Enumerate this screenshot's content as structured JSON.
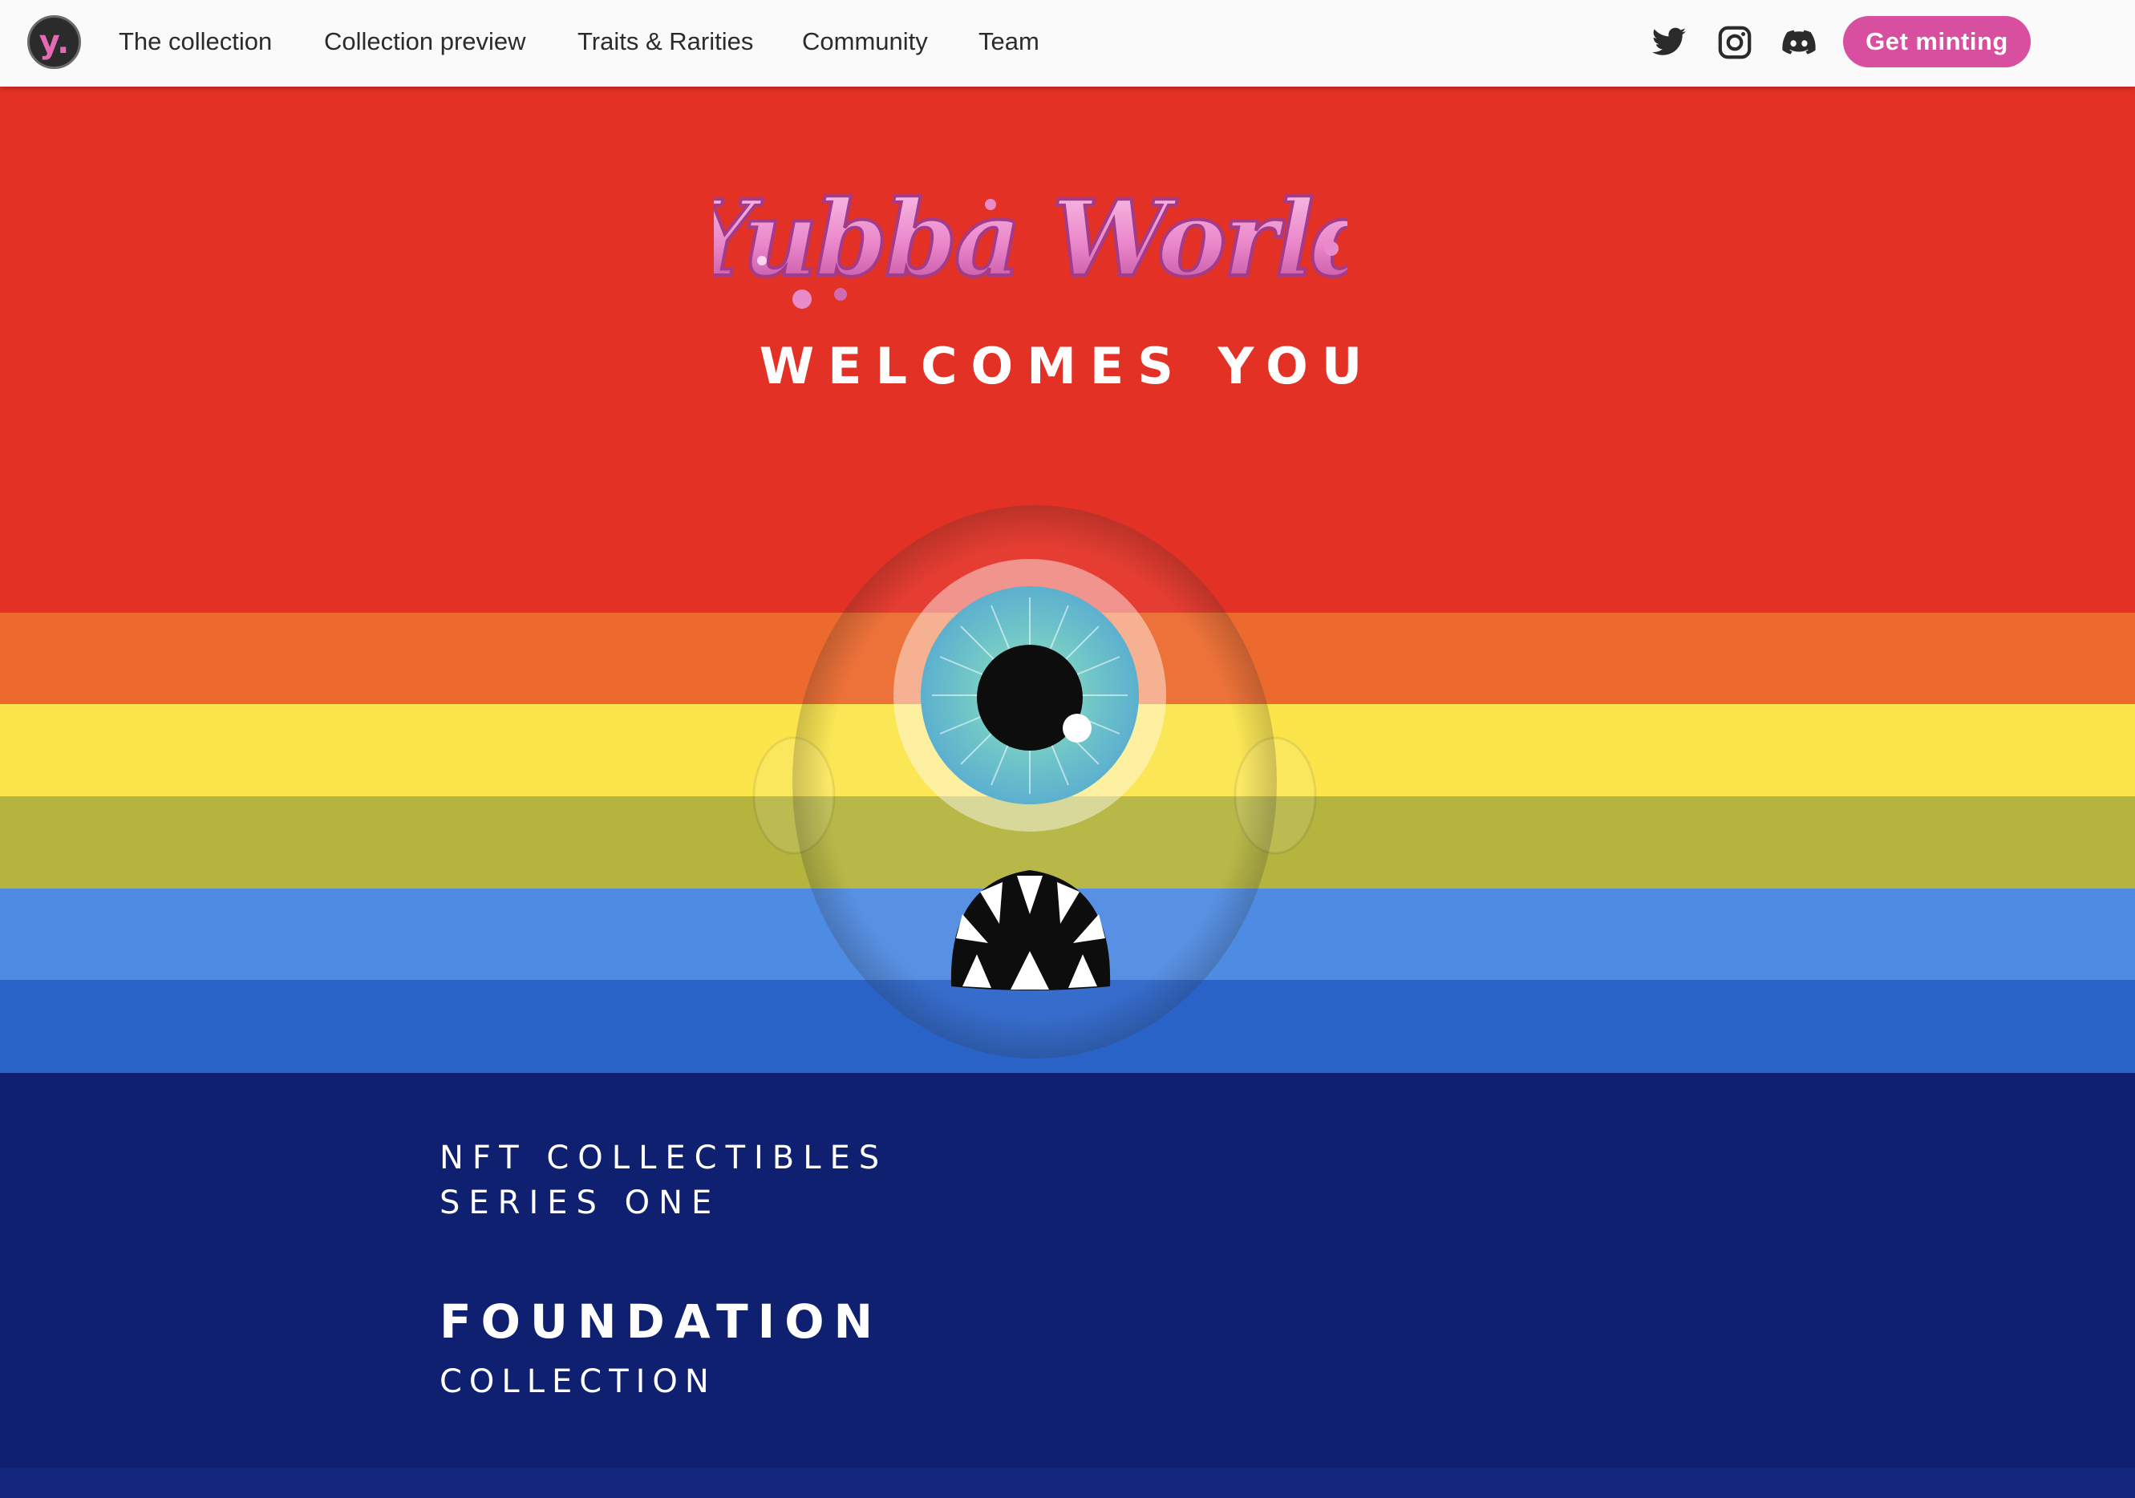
{
  "nav": {
    "logo_glyph": "y.",
    "links": [
      {
        "label": "The collection"
      },
      {
        "label": "Collection preview"
      },
      {
        "label": "Traits & Rarities"
      },
      {
        "label": "Community"
      },
      {
        "label": "Team"
      }
    ],
    "social_icons": [
      "twitter-icon",
      "instagram-icon",
      "discord-icon"
    ],
    "cta_label": "Get minting"
  },
  "hero": {
    "wordmark": "Yubba World",
    "welcome": "WELCOMES YOU"
  },
  "intro": {
    "line1": "NFT COLLECTIBLES",
    "line2": "SERIES ONE",
    "heading": "FOUNDATION",
    "subheading": "COLLECTION"
  },
  "colors": {
    "red": "#e43125",
    "orange": "#ec6a2d",
    "yellow": "#fbe54b",
    "olive": "#b4b43e",
    "blue": "#4e8be2",
    "dark_blue": "#2a63c8",
    "navy": "#0f2070",
    "accent_pink": "#d94fa0"
  }
}
